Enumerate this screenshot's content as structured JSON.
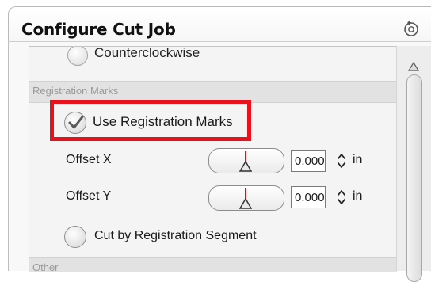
{
  "header": {
    "title": "Configure Cut Job",
    "reset_icon": "reset-icon"
  },
  "direction": {
    "option_label": "Counterclockwise"
  },
  "registration_section": {
    "heading": "Registration Marks",
    "use_registration_marks": {
      "label": "Use Registration Marks",
      "checked": true
    },
    "offset_x": {
      "label": "Offset X",
      "value": "0.000",
      "unit": "in"
    },
    "offset_y": {
      "label": "Offset Y",
      "value": "0.000",
      "unit": "in"
    },
    "cut_by_segment": {
      "label": "Cut by Registration Segment",
      "checked": false
    }
  },
  "other_section": {
    "heading": "Other"
  },
  "colors": {
    "highlight": "#e8121c",
    "slider_tick": "#d01818",
    "section_bg": "#e2e2e2",
    "section_text": "#9a9a9a"
  },
  "icons": {
    "checkmark": "checkmark-icon",
    "spinner": "spinner-icon",
    "slider_thumb": "triangle-thumb-icon",
    "scroll_up": "scroll-up-arrow-icon"
  }
}
